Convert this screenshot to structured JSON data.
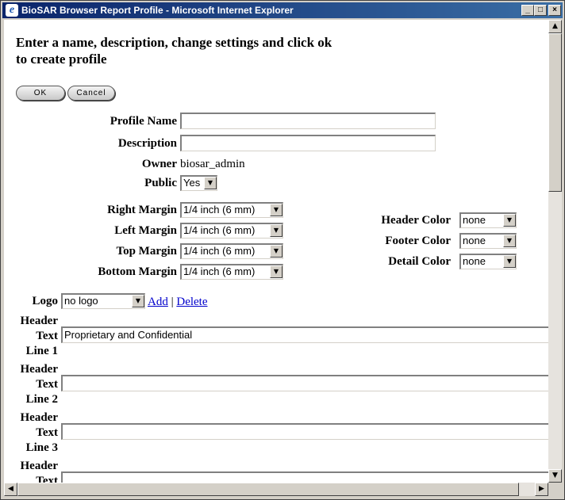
{
  "window": {
    "title": "BioSAR Browser Report Profile - Microsoft Internet Explorer"
  },
  "heading": "Enter a name, description, change settings and click ok to create profile",
  "buttons": {
    "ok": "OK",
    "cancel": "Cancel"
  },
  "form": {
    "profile_name": {
      "label": "Profile Name",
      "value": ""
    },
    "description": {
      "label": "Description",
      "value": ""
    },
    "owner": {
      "label": "Owner",
      "value": "biosar_admin"
    },
    "public": {
      "label": "Public",
      "value": "Yes"
    }
  },
  "margins": [
    {
      "label": "Right Margin",
      "value": "1/4 inch (6 mm)"
    },
    {
      "label": "Left Margin",
      "value": "1/4 inch (6 mm)"
    },
    {
      "label": "Top Margin",
      "value": "1/4 inch (6 mm)"
    },
    {
      "label": "Bottom Margin",
      "value": "1/4 inch (6 mm)"
    }
  ],
  "colors": [
    {
      "label": "Header Color",
      "value": "none"
    },
    {
      "label": "Footer Color",
      "value": "none"
    },
    {
      "label": "Detail Color",
      "value": "none"
    }
  ],
  "logo": {
    "label": "Logo",
    "value": "no logo",
    "add_link": "Add",
    "separator": "|",
    "delete_link": "Delete"
  },
  "header_text_lines": [
    {
      "label": [
        "Header",
        "Text",
        "Line 1"
      ],
      "value": "Proprietary and Confidential"
    },
    {
      "label": [
        "Header",
        "Text",
        "Line 2"
      ],
      "value": ""
    },
    {
      "label": [
        "Header",
        "Text",
        "Line 3"
      ],
      "value": ""
    },
    {
      "label": [
        "Header",
        "Text"
      ],
      "value": ""
    }
  ]
}
